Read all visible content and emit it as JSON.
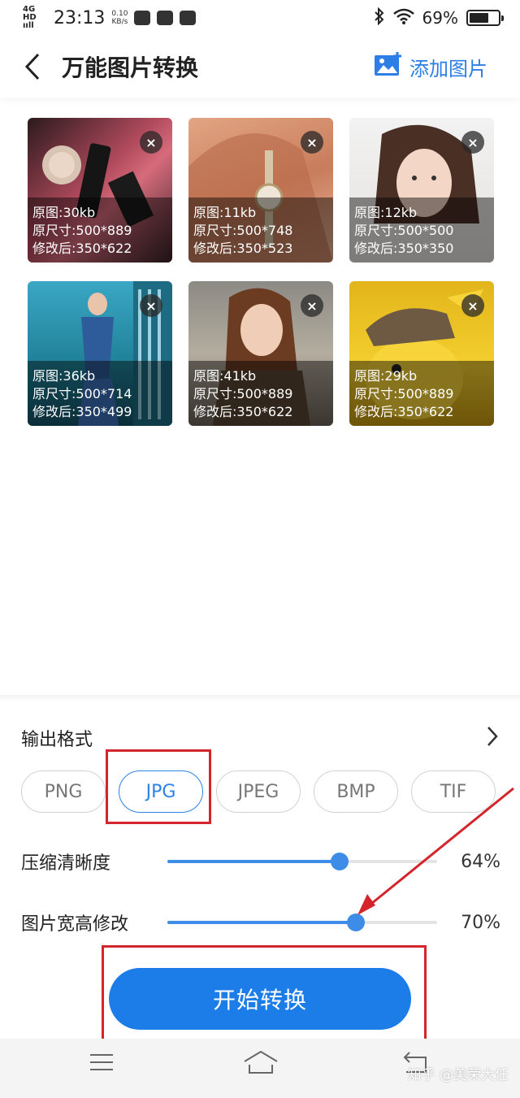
{
  "status_bar": {
    "network": "4G HD",
    "signal": "ııll",
    "time": "23:13",
    "speed_value": "0.10",
    "speed_unit": "KB/s",
    "battery": "69%",
    "battery_level": 0.69
  },
  "header": {
    "title": "万能图片转换",
    "add_image_label": "添加图片"
  },
  "images": [
    {
      "original_size": "原图:30kb",
      "original_dims": "原尺寸:500*889",
      "modified_dims": "修改后:350*622",
      "close": "×"
    },
    {
      "original_size": "原图:11kb",
      "original_dims": "原尺寸:500*748",
      "modified_dims": "修改后:350*523",
      "close": "×"
    },
    {
      "original_size": "原图:12kb",
      "original_dims": "原尺寸:500*500",
      "modified_dims": "修改后:350*350",
      "close": "×"
    },
    {
      "original_size": "原图:36kb",
      "original_dims": "原尺寸:500*714",
      "modified_dims": "修改后:350*499",
      "close": "×"
    },
    {
      "original_size": "原图:41kb",
      "original_dims": "原尺寸:500*889",
      "modified_dims": "修改后:350*622",
      "close": "×"
    },
    {
      "original_size": "原图:29kb",
      "original_dims": "原尺寸:500*889",
      "modified_dims": "修改后:350*622",
      "close": "×"
    }
  ],
  "settings": {
    "output_format_label": "输出格式",
    "formats": [
      "PNG",
      "JPG",
      "JPEG",
      "BMP",
      "TIF"
    ],
    "selected_format": "JPG",
    "compression": {
      "label": "压缩清晰度",
      "value": "64%",
      "level": 0.64
    },
    "resize": {
      "label": "图片宽高修改",
      "value": "70%",
      "level": 0.7
    }
  },
  "start_button_label": "开始转换",
  "watermark": "知乎 @美荣大任",
  "colors": {
    "accent": "#1d7de8",
    "annotation": "#d4252d"
  }
}
